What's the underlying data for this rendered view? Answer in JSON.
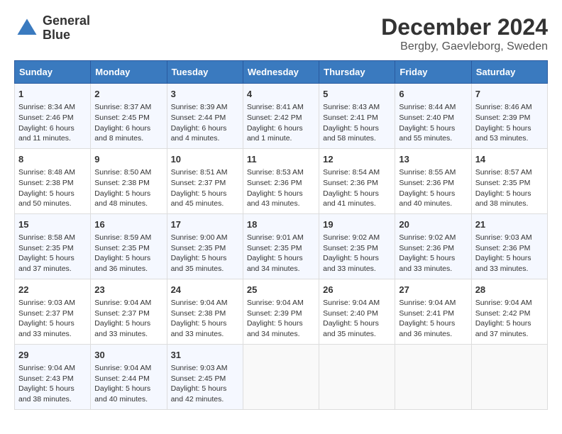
{
  "logo": {
    "line1": "General",
    "line2": "Blue"
  },
  "title": "December 2024",
  "subtitle": "Bergby, Gaevleborg, Sweden",
  "headers": [
    "Sunday",
    "Monday",
    "Tuesday",
    "Wednesday",
    "Thursday",
    "Friday",
    "Saturday"
  ],
  "weeks": [
    [
      {
        "day": "1",
        "sunrise": "Sunrise: 8:34 AM",
        "sunset": "Sunset: 2:46 PM",
        "daylight": "Daylight: 6 hours and 11 minutes."
      },
      {
        "day": "2",
        "sunrise": "Sunrise: 8:37 AM",
        "sunset": "Sunset: 2:45 PM",
        "daylight": "Daylight: 6 hours and 8 minutes."
      },
      {
        "day": "3",
        "sunrise": "Sunrise: 8:39 AM",
        "sunset": "Sunset: 2:44 PM",
        "daylight": "Daylight: 6 hours and 4 minutes."
      },
      {
        "day": "4",
        "sunrise": "Sunrise: 8:41 AM",
        "sunset": "Sunset: 2:42 PM",
        "daylight": "Daylight: 6 hours and 1 minute."
      },
      {
        "day": "5",
        "sunrise": "Sunrise: 8:43 AM",
        "sunset": "Sunset: 2:41 PM",
        "daylight": "Daylight: 5 hours and 58 minutes."
      },
      {
        "day": "6",
        "sunrise": "Sunrise: 8:44 AM",
        "sunset": "Sunset: 2:40 PM",
        "daylight": "Daylight: 5 hours and 55 minutes."
      },
      {
        "day": "7",
        "sunrise": "Sunrise: 8:46 AM",
        "sunset": "Sunset: 2:39 PM",
        "daylight": "Daylight: 5 hours and 53 minutes."
      }
    ],
    [
      {
        "day": "8",
        "sunrise": "Sunrise: 8:48 AM",
        "sunset": "Sunset: 2:38 PM",
        "daylight": "Daylight: 5 hours and 50 minutes."
      },
      {
        "day": "9",
        "sunrise": "Sunrise: 8:50 AM",
        "sunset": "Sunset: 2:38 PM",
        "daylight": "Daylight: 5 hours and 48 minutes."
      },
      {
        "day": "10",
        "sunrise": "Sunrise: 8:51 AM",
        "sunset": "Sunset: 2:37 PM",
        "daylight": "Daylight: 5 hours and 45 minutes."
      },
      {
        "day": "11",
        "sunrise": "Sunrise: 8:53 AM",
        "sunset": "Sunset: 2:36 PM",
        "daylight": "Daylight: 5 hours and 43 minutes."
      },
      {
        "day": "12",
        "sunrise": "Sunrise: 8:54 AM",
        "sunset": "Sunset: 2:36 PM",
        "daylight": "Daylight: 5 hours and 41 minutes."
      },
      {
        "day": "13",
        "sunrise": "Sunrise: 8:55 AM",
        "sunset": "Sunset: 2:36 PM",
        "daylight": "Daylight: 5 hours and 40 minutes."
      },
      {
        "day": "14",
        "sunrise": "Sunrise: 8:57 AM",
        "sunset": "Sunset: 2:35 PM",
        "daylight": "Daylight: 5 hours and 38 minutes."
      }
    ],
    [
      {
        "day": "15",
        "sunrise": "Sunrise: 8:58 AM",
        "sunset": "Sunset: 2:35 PM",
        "daylight": "Daylight: 5 hours and 37 minutes."
      },
      {
        "day": "16",
        "sunrise": "Sunrise: 8:59 AM",
        "sunset": "Sunset: 2:35 PM",
        "daylight": "Daylight: 5 hours and 36 minutes."
      },
      {
        "day": "17",
        "sunrise": "Sunrise: 9:00 AM",
        "sunset": "Sunset: 2:35 PM",
        "daylight": "Daylight: 5 hours and 35 minutes."
      },
      {
        "day": "18",
        "sunrise": "Sunrise: 9:01 AM",
        "sunset": "Sunset: 2:35 PM",
        "daylight": "Daylight: 5 hours and 34 minutes."
      },
      {
        "day": "19",
        "sunrise": "Sunrise: 9:02 AM",
        "sunset": "Sunset: 2:35 PM",
        "daylight": "Daylight: 5 hours and 33 minutes."
      },
      {
        "day": "20",
        "sunrise": "Sunrise: 9:02 AM",
        "sunset": "Sunset: 2:36 PM",
        "daylight": "Daylight: 5 hours and 33 minutes."
      },
      {
        "day": "21",
        "sunrise": "Sunrise: 9:03 AM",
        "sunset": "Sunset: 2:36 PM",
        "daylight": "Daylight: 5 hours and 33 minutes."
      }
    ],
    [
      {
        "day": "22",
        "sunrise": "Sunrise: 9:03 AM",
        "sunset": "Sunset: 2:37 PM",
        "daylight": "Daylight: 5 hours and 33 minutes."
      },
      {
        "day": "23",
        "sunrise": "Sunrise: 9:04 AM",
        "sunset": "Sunset: 2:37 PM",
        "daylight": "Daylight: 5 hours and 33 minutes."
      },
      {
        "day": "24",
        "sunrise": "Sunrise: 9:04 AM",
        "sunset": "Sunset: 2:38 PM",
        "daylight": "Daylight: 5 hours and 33 minutes."
      },
      {
        "day": "25",
        "sunrise": "Sunrise: 9:04 AM",
        "sunset": "Sunset: 2:39 PM",
        "daylight": "Daylight: 5 hours and 34 minutes."
      },
      {
        "day": "26",
        "sunrise": "Sunrise: 9:04 AM",
        "sunset": "Sunset: 2:40 PM",
        "daylight": "Daylight: 5 hours and 35 minutes."
      },
      {
        "day": "27",
        "sunrise": "Sunrise: 9:04 AM",
        "sunset": "Sunset: 2:41 PM",
        "daylight": "Daylight: 5 hours and 36 minutes."
      },
      {
        "day": "28",
        "sunrise": "Sunrise: 9:04 AM",
        "sunset": "Sunset: 2:42 PM",
        "daylight": "Daylight: 5 hours and 37 minutes."
      }
    ],
    [
      {
        "day": "29",
        "sunrise": "Sunrise: 9:04 AM",
        "sunset": "Sunset: 2:43 PM",
        "daylight": "Daylight: 5 hours and 38 minutes."
      },
      {
        "day": "30",
        "sunrise": "Sunrise: 9:04 AM",
        "sunset": "Sunset: 2:44 PM",
        "daylight": "Daylight: 5 hours and 40 minutes."
      },
      {
        "day": "31",
        "sunrise": "Sunrise: 9:03 AM",
        "sunset": "Sunset: 2:45 PM",
        "daylight": "Daylight: 5 hours and 42 minutes."
      },
      null,
      null,
      null,
      null
    ]
  ]
}
